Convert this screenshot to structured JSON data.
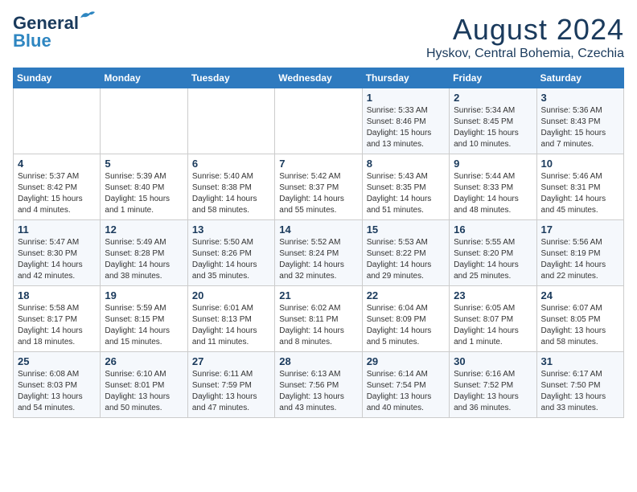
{
  "header": {
    "logo_line1": "General",
    "logo_line2": "Blue",
    "month_title": "August 2024",
    "location": "Hyskov, Central Bohemia, Czechia"
  },
  "weekdays": [
    "Sunday",
    "Monday",
    "Tuesday",
    "Wednesday",
    "Thursday",
    "Friday",
    "Saturday"
  ],
  "weeks": [
    [
      {
        "day": "",
        "info": ""
      },
      {
        "day": "",
        "info": ""
      },
      {
        "day": "",
        "info": ""
      },
      {
        "day": "",
        "info": ""
      },
      {
        "day": "1",
        "info": "Sunrise: 5:33 AM\nSunset: 8:46 PM\nDaylight: 15 hours\nand 13 minutes."
      },
      {
        "day": "2",
        "info": "Sunrise: 5:34 AM\nSunset: 8:45 PM\nDaylight: 15 hours\nand 10 minutes."
      },
      {
        "day": "3",
        "info": "Sunrise: 5:36 AM\nSunset: 8:43 PM\nDaylight: 15 hours\nand 7 minutes."
      }
    ],
    [
      {
        "day": "4",
        "info": "Sunrise: 5:37 AM\nSunset: 8:42 PM\nDaylight: 15 hours\nand 4 minutes."
      },
      {
        "day": "5",
        "info": "Sunrise: 5:39 AM\nSunset: 8:40 PM\nDaylight: 15 hours\nand 1 minute."
      },
      {
        "day": "6",
        "info": "Sunrise: 5:40 AM\nSunset: 8:38 PM\nDaylight: 14 hours\nand 58 minutes."
      },
      {
        "day": "7",
        "info": "Sunrise: 5:42 AM\nSunset: 8:37 PM\nDaylight: 14 hours\nand 55 minutes."
      },
      {
        "day": "8",
        "info": "Sunrise: 5:43 AM\nSunset: 8:35 PM\nDaylight: 14 hours\nand 51 minutes."
      },
      {
        "day": "9",
        "info": "Sunrise: 5:44 AM\nSunset: 8:33 PM\nDaylight: 14 hours\nand 48 minutes."
      },
      {
        "day": "10",
        "info": "Sunrise: 5:46 AM\nSunset: 8:31 PM\nDaylight: 14 hours\nand 45 minutes."
      }
    ],
    [
      {
        "day": "11",
        "info": "Sunrise: 5:47 AM\nSunset: 8:30 PM\nDaylight: 14 hours\nand 42 minutes."
      },
      {
        "day": "12",
        "info": "Sunrise: 5:49 AM\nSunset: 8:28 PM\nDaylight: 14 hours\nand 38 minutes."
      },
      {
        "day": "13",
        "info": "Sunrise: 5:50 AM\nSunset: 8:26 PM\nDaylight: 14 hours\nand 35 minutes."
      },
      {
        "day": "14",
        "info": "Sunrise: 5:52 AM\nSunset: 8:24 PM\nDaylight: 14 hours\nand 32 minutes."
      },
      {
        "day": "15",
        "info": "Sunrise: 5:53 AM\nSunset: 8:22 PM\nDaylight: 14 hours\nand 29 minutes."
      },
      {
        "day": "16",
        "info": "Sunrise: 5:55 AM\nSunset: 8:20 PM\nDaylight: 14 hours\nand 25 minutes."
      },
      {
        "day": "17",
        "info": "Sunrise: 5:56 AM\nSunset: 8:19 PM\nDaylight: 14 hours\nand 22 minutes."
      }
    ],
    [
      {
        "day": "18",
        "info": "Sunrise: 5:58 AM\nSunset: 8:17 PM\nDaylight: 14 hours\nand 18 minutes."
      },
      {
        "day": "19",
        "info": "Sunrise: 5:59 AM\nSunset: 8:15 PM\nDaylight: 14 hours\nand 15 minutes."
      },
      {
        "day": "20",
        "info": "Sunrise: 6:01 AM\nSunset: 8:13 PM\nDaylight: 14 hours\nand 11 minutes."
      },
      {
        "day": "21",
        "info": "Sunrise: 6:02 AM\nSunset: 8:11 PM\nDaylight: 14 hours\nand 8 minutes."
      },
      {
        "day": "22",
        "info": "Sunrise: 6:04 AM\nSunset: 8:09 PM\nDaylight: 14 hours\nand 5 minutes."
      },
      {
        "day": "23",
        "info": "Sunrise: 6:05 AM\nSunset: 8:07 PM\nDaylight: 14 hours\nand 1 minute."
      },
      {
        "day": "24",
        "info": "Sunrise: 6:07 AM\nSunset: 8:05 PM\nDaylight: 13 hours\nand 58 minutes."
      }
    ],
    [
      {
        "day": "25",
        "info": "Sunrise: 6:08 AM\nSunset: 8:03 PM\nDaylight: 13 hours\nand 54 minutes."
      },
      {
        "day": "26",
        "info": "Sunrise: 6:10 AM\nSunset: 8:01 PM\nDaylight: 13 hours\nand 50 minutes."
      },
      {
        "day": "27",
        "info": "Sunrise: 6:11 AM\nSunset: 7:59 PM\nDaylight: 13 hours\nand 47 minutes."
      },
      {
        "day": "28",
        "info": "Sunrise: 6:13 AM\nSunset: 7:56 PM\nDaylight: 13 hours\nand 43 minutes."
      },
      {
        "day": "29",
        "info": "Sunrise: 6:14 AM\nSunset: 7:54 PM\nDaylight: 13 hours\nand 40 minutes."
      },
      {
        "day": "30",
        "info": "Sunrise: 6:16 AM\nSunset: 7:52 PM\nDaylight: 13 hours\nand 36 minutes."
      },
      {
        "day": "31",
        "info": "Sunrise: 6:17 AM\nSunset: 7:50 PM\nDaylight: 13 hours\nand 33 minutes."
      }
    ]
  ]
}
